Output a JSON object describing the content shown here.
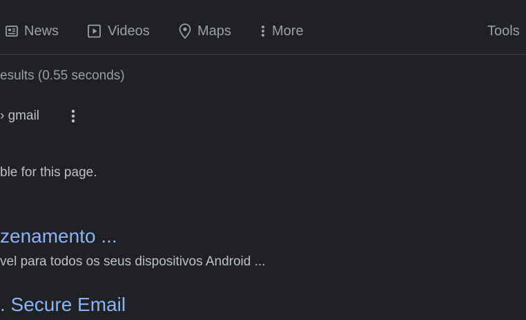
{
  "nav": {
    "tabs": [
      {
        "label": "News",
        "icon": "news-icon"
      },
      {
        "label": "Videos",
        "icon": "video-icon"
      },
      {
        "label": "Maps",
        "icon": "map-pin-icon"
      },
      {
        "label": "More",
        "icon": "more-vertical-icon"
      }
    ],
    "tools_label": "Tools"
  },
  "results": {
    "stats_text": "esults (0.55 seconds)",
    "items": [
      {
        "breadcrumb": "› gmail",
        "snippet": "ble for this page."
      },
      {
        "title": "zenamento ...",
        "snippet": "vel para todos os seus dispositivos Android ..."
      },
      {
        "title": ". Secure Email"
      }
    ]
  },
  "colors": {
    "background": "#202124",
    "link": "#8ab4f8",
    "text": "#bdc1c6",
    "muted": "#9aa0a6",
    "divider": "#3c4043"
  }
}
